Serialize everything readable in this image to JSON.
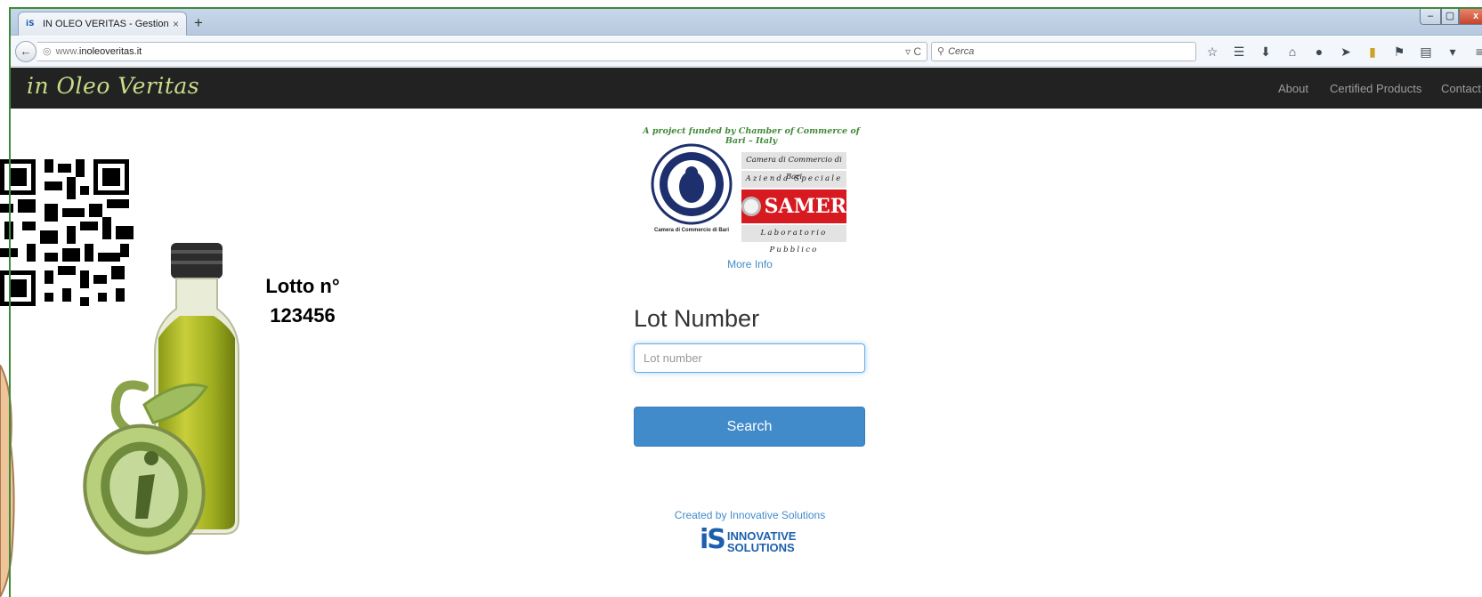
{
  "browser": {
    "tab_title": "IN OLEO VERITAS - Gestion...",
    "tab_close": "×",
    "new_tab": "+",
    "url_prefix": "www.",
    "url_domain": "inoleoveritas.it",
    "search_placeholder": "Cerca",
    "window_controls": {
      "minimize": "–",
      "maximize": "▢",
      "close": "x"
    },
    "toolbar_icons": [
      "star-icon",
      "reading-list-icon",
      "download-icon",
      "home-icon",
      "chat-icon",
      "send-icon",
      "bookmark-icon",
      "addon-icon",
      "clipboard-icon",
      "dropdown-icon",
      "menu-icon"
    ]
  },
  "site": {
    "brand": "in Oleo Veritas",
    "nav": {
      "about": "About",
      "certified": "Certified Products",
      "contact": "Contact"
    },
    "funded_by": "A project funded by Chamber of Commerce of Bari – Italy",
    "seal_caption": "Camera di Commercio di Bari",
    "cc_lines": {
      "camera": "Camera di Commercio di Bari",
      "azienda": "Azienda Speciale",
      "samer": "SAMER",
      "lab": "Laboratorio Pubblico"
    },
    "more_info": "More Info",
    "lot_heading": "Lot Number",
    "lot_placeholder": "Lot number",
    "search_button": "Search",
    "created_by": "Created by Innovative Solutions",
    "logo": {
      "mark": "iS",
      "line1": "Innovative",
      "line2": "Solutions"
    }
  },
  "overlay": {
    "lotto_line1": "Lotto n°",
    "lotto_line2": "123456"
  },
  "colors": {
    "brand_green": "#c8dc8a",
    "funded_green": "#3e8a37",
    "primary_blue": "#428bca",
    "samer_red": "#d71920",
    "header_dark": "#222222"
  }
}
